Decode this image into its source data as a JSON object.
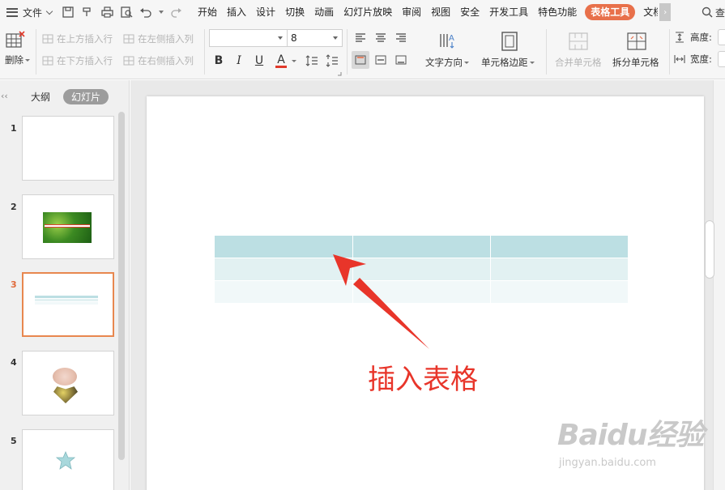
{
  "menu": {
    "file_label": "文件",
    "tabs": [
      "开始",
      "插入",
      "设计",
      "切换",
      "动画",
      "幻灯片放映",
      "审阅",
      "视图",
      "安全",
      "开发工具",
      "特色功能",
      "表格工具",
      "文档"
    ],
    "active_tab": "表格工具",
    "right_search": "查"
  },
  "ribbon": {
    "delete_label": "删除",
    "insert_above": "在上方插入行",
    "insert_below": "在下方插入行",
    "insert_left": "在左侧插入列",
    "insert_right": "在右侧插入列",
    "font_name": "",
    "font_size": "8",
    "bold": "B",
    "italic": "I",
    "underline": "U",
    "font_color": "A",
    "text_direction": "文字方向",
    "cell_margin": "单元格边距",
    "merge_cells": "合并单元格",
    "split_cells": "拆分单元格",
    "height_label": "高度:",
    "width_label": "宽度:"
  },
  "left_panel": {
    "outline_tab": "大纲",
    "slides_tab": "幻灯片",
    "slides": [
      {
        "num": "1"
      },
      {
        "num": "2"
      },
      {
        "num": "3"
      },
      {
        "num": "4"
      },
      {
        "num": "5"
      }
    ],
    "current_slide": "3"
  },
  "editor": {
    "annotation": "插入表格"
  },
  "watermark": {
    "brand": "Baidu经验",
    "site": "jingyan.baidu.com"
  },
  "colors": {
    "accent_tab": "#e8704a",
    "table_header": "#bcdfe3",
    "table_row1": "#e2f1f2",
    "table_row2": "#f1f8f9",
    "annotation": "#e8352a",
    "current_slide_border": "#e8874f"
  }
}
